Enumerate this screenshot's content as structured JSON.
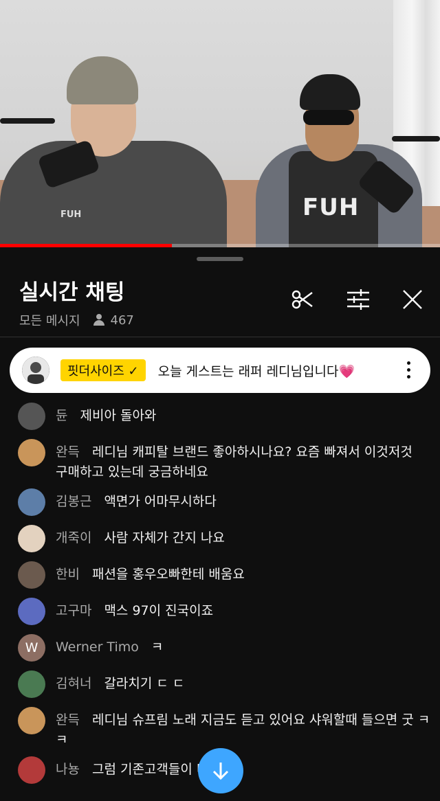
{
  "video": {
    "progress_fraction": 0.39,
    "shirt_logo_left": "FUH",
    "shirt_logo_right": "FUH"
  },
  "header": {
    "title": "실시간 채팅",
    "filter_label": "모든 메시지",
    "viewer_count": "467"
  },
  "icons": {
    "clip": "scissors-icon",
    "settings": "sliders-icon",
    "close": "close-icon",
    "viewers": "person-icon",
    "scroll_down": "arrow-down-icon",
    "more": "more-vert-icon"
  },
  "pinned": {
    "badge": "핏더사이즈 ✓",
    "text": "오늘 게스트는 래퍼 레디님입니다💗"
  },
  "colors": {
    "badge_bg": "#ffd400",
    "fab_bg": "#3ea6ff",
    "progress": "#ff0000"
  },
  "messages": [
    {
      "author": "듄",
      "text": "제비아 돌아와",
      "avatar_color": "#555555"
    },
    {
      "author": "완득",
      "text": "레디님 캐피탈 브랜드 좋아하시나요? 요즘 빠져서 이것저것",
      "text2": "구매하고 있는데 궁금하네요",
      "avatar_color": "#c9955a"
    },
    {
      "author": "김봉근",
      "text": "액면가 어마무시하다",
      "avatar_color": "#5d7ea8"
    },
    {
      "author": "개죽이",
      "text": "사람 자체가 간지 나요",
      "avatar_color": "#e3d2bf"
    },
    {
      "author": "한비",
      "text": "패션을 홍우오빠한테 배움요",
      "avatar_color": "#6b5a4e"
    },
    {
      "author": "고구마",
      "text": "맥스 97이 진국이죠",
      "avatar_color": "#5c6bc0"
    },
    {
      "author": "Werner Timo",
      "text": "ㅋ",
      "avatar_color": "#8d6e63",
      "initial": "W"
    },
    {
      "author": "김혀너",
      "text": "갈라치기 ㄷ ㄷ",
      "avatar_color": "#4a7a52"
    },
    {
      "author": "완득",
      "text": "레디님 슈프림 노래 지금도 듣고 있어요 샤워할때 들으면 굿 ㅋ",
      "text2": "ㅋ",
      "avatar_color": "#c9955a"
    },
    {
      "author": "나뇽",
      "text": "그럼 기존고객들이 더",
      "avatar_color": "#b33a3a"
    }
  ]
}
